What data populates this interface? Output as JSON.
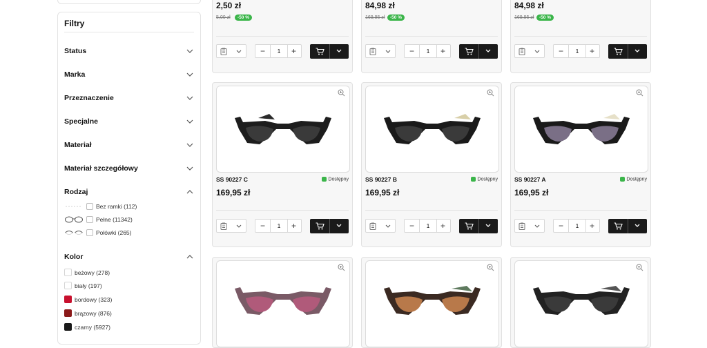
{
  "filters": {
    "title": "Filtry",
    "sections": [
      {
        "label": "Status"
      },
      {
        "label": "Marka"
      },
      {
        "label": "Przeznaczenie"
      },
      {
        "label": "Specjalne"
      },
      {
        "label": "Materiał"
      },
      {
        "label": "Materiał szczegółowy"
      },
      {
        "label": "Rodzaj"
      },
      {
        "label": "Kolor"
      }
    ],
    "rodzaj_options": [
      {
        "label": "Bez ramki (112)"
      },
      {
        "label": "Pełne (11342)"
      },
      {
        "label": "Połówki (265)"
      }
    ],
    "kolor_options": [
      {
        "label": "beżowy (278)",
        "color": "#ffffff"
      },
      {
        "label": "biały (197)",
        "color": "#ffffff"
      },
      {
        "label": "bordowy (323)",
        "color": "#c8102e"
      },
      {
        "label": "brązowy (876)",
        "color": "#8b1a1a"
      },
      {
        "label": "czarny (5927)",
        "color": "#1a1a1a"
      }
    ]
  },
  "products_top": [
    {
      "price": "2,50 zł",
      "old_price": "5,00 zł",
      "discount": "-50 %",
      "qty": "1"
    },
    {
      "price": "84,98 zł",
      "old_price": "169,95 zł",
      "discount": "-50 %",
      "qty": "1"
    },
    {
      "price": "84,98 zł",
      "old_price": "169,95 zł",
      "discount": "-50 %",
      "qty": "1"
    }
  ],
  "products_mid": [
    {
      "sku": "SS 90227 C",
      "availability": "Dostępny",
      "price": "169,95 zł",
      "qty": "1",
      "lens": "#3a3a3a"
    },
    {
      "sku": "SS 90227 B",
      "availability": "Dostępny",
      "price": "169,95 zł",
      "qty": "1",
      "lens": "#3a3a3a"
    },
    {
      "sku": "SS 90227 A",
      "availability": "Dostępny",
      "price": "169,95 zł",
      "qty": "1",
      "lens": "#7a6f86"
    }
  ],
  "products_bottom": [
    {
      "lens": "#b05a7a",
      "frame": "#7a5a66"
    },
    {
      "lens": "#b8794a",
      "frame": "#3b2a22"
    },
    {
      "lens": "#3a3a3a",
      "frame": "#222222"
    }
  ],
  "colors": {
    "accent_green": "#3bb54a",
    "cart_button": "#1a1a1a"
  }
}
